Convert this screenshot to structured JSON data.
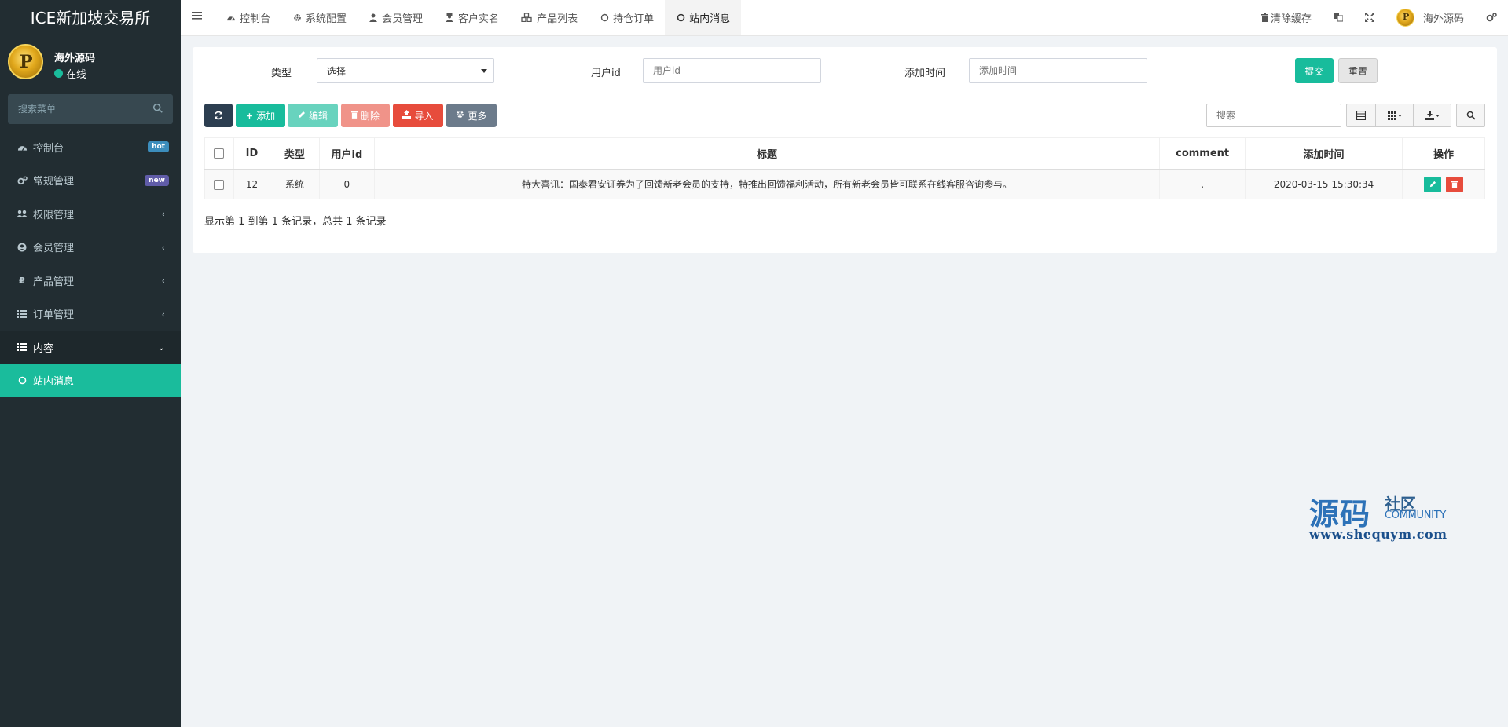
{
  "app": {
    "title": "ICE新加坡交易所"
  },
  "user": {
    "name": "海外源码",
    "status": "在线",
    "avatar_letter": "P"
  },
  "sidebar": {
    "search_placeholder": "搜索菜单",
    "items": [
      {
        "label": "控制台",
        "icon": "dashboard-icon",
        "badge": "hot"
      },
      {
        "label": "常规管理",
        "icon": "cogs-icon",
        "badge": "new"
      },
      {
        "label": "权限管理",
        "icon": "users-icon"
      },
      {
        "label": "会员管理",
        "icon": "user-circle-icon"
      },
      {
        "label": "产品管理",
        "icon": "ruble-icon"
      },
      {
        "label": "订单管理",
        "icon": "list-icon"
      },
      {
        "label": "内容",
        "icon": "list-icon"
      },
      {
        "label": "站内消息",
        "icon": "circle-icon"
      }
    ]
  },
  "topnav": {
    "tabs": [
      {
        "label": "控制台",
        "icon": "dashboard-icon"
      },
      {
        "label": "系统配置",
        "icon": "gear-icon"
      },
      {
        "label": "会员管理",
        "icon": "user-icon"
      },
      {
        "label": "客户实名",
        "icon": "user-secret-icon"
      },
      {
        "label": "产品列表",
        "icon": "cubes-icon"
      },
      {
        "label": "持仓订单",
        "icon": "circle-icon"
      },
      {
        "label": "站内消息",
        "icon": "circle-icon"
      }
    ],
    "clear_cache": "清除缓存",
    "user_name": "海外源码"
  },
  "filters": {
    "type_label": "类型",
    "type_value": "选择",
    "userid_label": "用户id",
    "userid_placeholder": "用户id",
    "addtime_label": "添加时间",
    "addtime_placeholder": "添加时间",
    "submit": "提交",
    "reset": "重置"
  },
  "toolbar": {
    "add": "添加",
    "edit": "编辑",
    "delete": "删除",
    "import": "导入",
    "more": "更多",
    "search_placeholder": "搜索"
  },
  "table": {
    "headers": [
      "ID",
      "类型",
      "用户id",
      "标题",
      "comment",
      "添加时间",
      "操作"
    ],
    "rows": [
      {
        "id": "12",
        "type": "系统",
        "userid": "0",
        "title": "特大喜讯：国泰君安证券为了回馈新老会员的支持，特推出回馈福利活动，所有新老会员皆可联系在线客服咨询参与。",
        "comment": ".",
        "addtime": "2020-03-15 15:30:34"
      }
    ],
    "summary": "显示第 1 到第 1 条记录，总共 1 条记录"
  },
  "watermark": {
    "big": "源码",
    "small1": "社区",
    "small2": "COMMUNITY",
    "url": "www.shequym.com"
  },
  "colors": {
    "sidebar_bg": "#222d32",
    "accent": "#18bc9c",
    "danger": "#e74c3c",
    "dark": "#2c3e50"
  }
}
